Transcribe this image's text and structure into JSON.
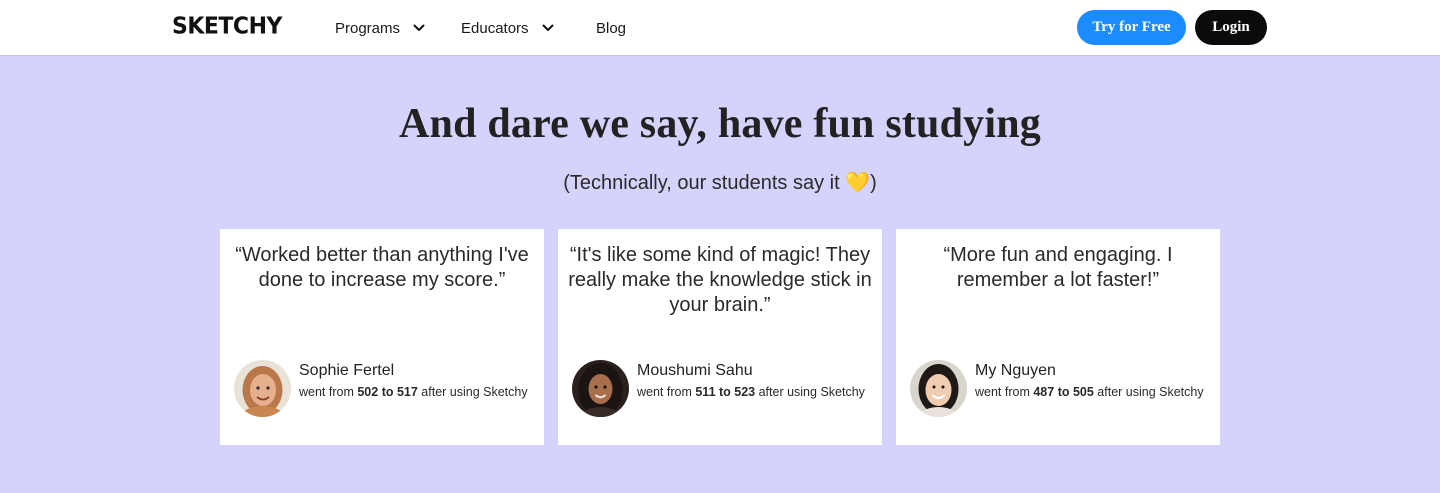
{
  "header": {
    "logo": "SKETCHY",
    "nav": [
      {
        "label": "Programs",
        "has_dropdown": true
      },
      {
        "label": "Educators",
        "has_dropdown": true
      },
      {
        "label": "Blog",
        "has_dropdown": false
      }
    ],
    "try_label": "Try for Free",
    "login_label": "Login"
  },
  "hero": {
    "title": "And dare we say, have fun studying",
    "subtitle_text": "(Technically, our students say it ",
    "subtitle_emoji": "💛",
    "subtitle_end": ")"
  },
  "testimonials": [
    {
      "quote": "“Worked better than anything I've done to increase my score.”",
      "name": "Sophie Fertel",
      "prefix": "went from ",
      "range": "502 to 517",
      "suffix": " after using Sketchy"
    },
    {
      "quote": "“It's like some kind of magic! They really make the knowledge stick in your brain.”",
      "name": "Moushumi Sahu",
      "prefix": "went from ",
      "range": "511 to 523",
      "suffix": " after using Sketchy"
    },
    {
      "quote": "“More fun and engaging. I remember a lot faster!”",
      "name": "My Nguyen",
      "prefix": "went from ",
      "range": "487 to 505",
      "suffix": " after using Sketchy"
    }
  ],
  "colors": {
    "background": "#d5d3fb",
    "try_button": "#1a8cff",
    "login_button": "#0b0b0b"
  },
  "icons": {
    "dropdown": "chevron-down-icon"
  }
}
